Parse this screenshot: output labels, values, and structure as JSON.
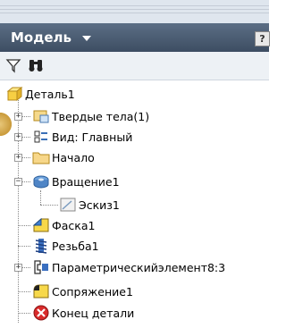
{
  "panel": {
    "title": "Модель",
    "help_label": "?"
  },
  "toolbar": {
    "filter_icon": "filter-icon",
    "search_icon": "binoculars-icon"
  },
  "tree": {
    "root": {
      "label": "Деталь1",
      "icon": "part-icon"
    },
    "items": [
      {
        "label": "Твердые тела(1)",
        "icon": "solid-bodies-icon",
        "expandable": true
      },
      {
        "label": "Вид: Главный",
        "icon": "view-icon",
        "expandable": true
      },
      {
        "label": "Начало",
        "icon": "folder-icon",
        "expandable": true
      },
      {
        "label": "Вращение1",
        "icon": "revolve-icon",
        "expandable": true
      },
      {
        "label": "Эскиз1",
        "icon": "sketch-icon",
        "expandable": false
      },
      {
        "label": "Фаска1",
        "icon": "chamfer-icon",
        "expandable": false
      },
      {
        "label": "Резьба1",
        "icon": "thread-icon",
        "expandable": false
      },
      {
        "label": "Параметрическийэлемент8:3",
        "icon": "ifeature-icon",
        "expandable": true
      },
      {
        "label": "Сопряжение1",
        "icon": "fillet-icon",
        "expandable": false
      },
      {
        "label": "Конец детали",
        "icon": "end-of-part-icon",
        "expandable": false
      }
    ]
  },
  "colors": {
    "header_bg": "#4a5a70",
    "toolbar_bg": "#edf1f5",
    "accent_folder": "#f2c85b"
  }
}
